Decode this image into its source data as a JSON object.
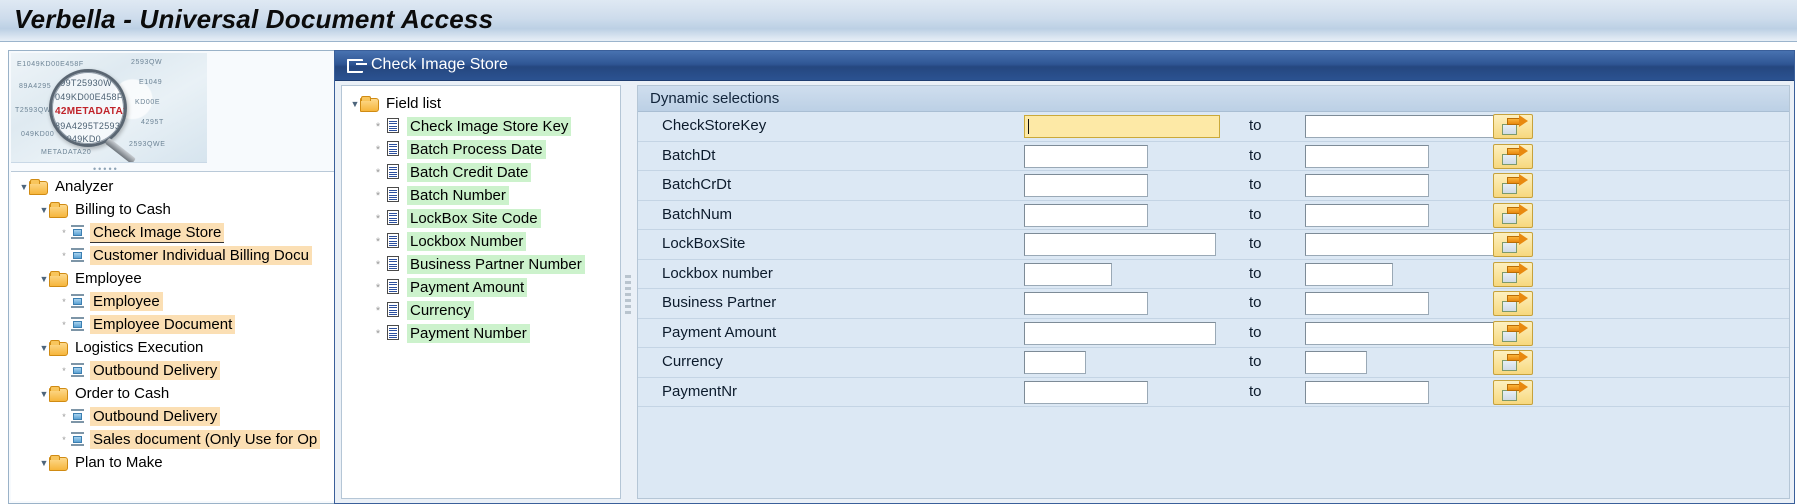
{
  "header": {
    "title": "Verbella - Universal Document Access"
  },
  "thumbnail": {
    "name": "metadata-magnifier-image",
    "lens_lines": [
      "299T25930W",
      "049KD00E458F",
      "42METADATA20",
      "89A4295T2593",
      "E1049KD0"
    ],
    "highlight_word": "METADATA"
  },
  "tree": {
    "items": [
      {
        "label": "Analyzer",
        "type": "folder",
        "depth": 0,
        "expanded": true,
        "highlight": "none"
      },
      {
        "label": "Billing to Cash",
        "type": "folder",
        "depth": 1,
        "expanded": true,
        "highlight": "none"
      },
      {
        "label": "Check Image Store",
        "type": "cube",
        "depth": 2,
        "expanded": false,
        "highlight": "orange",
        "selected": true
      },
      {
        "label": "Customer Individual Billing Docu",
        "type": "cube",
        "depth": 2,
        "expanded": false,
        "highlight": "orange"
      },
      {
        "label": "Employee",
        "type": "folder",
        "depth": 1,
        "expanded": true,
        "highlight": "none"
      },
      {
        "label": "Employee",
        "type": "cube",
        "depth": 2,
        "expanded": false,
        "highlight": "orange"
      },
      {
        "label": "Employee Document",
        "type": "cube",
        "depth": 2,
        "expanded": false,
        "highlight": "orange"
      },
      {
        "label": "Logistics Execution",
        "type": "folder",
        "depth": 1,
        "expanded": true,
        "highlight": "none"
      },
      {
        "label": "Outbound Delivery",
        "type": "cube",
        "depth": 2,
        "expanded": false,
        "highlight": "orange"
      },
      {
        "label": "Order to Cash",
        "type": "folder",
        "depth": 1,
        "expanded": true,
        "highlight": "none"
      },
      {
        "label": "Outbound Delivery",
        "type": "cube",
        "depth": 2,
        "expanded": false,
        "highlight": "orange"
      },
      {
        "label": "Sales document (Only Use for Op",
        "type": "cube",
        "depth": 2,
        "expanded": false,
        "highlight": "orange"
      },
      {
        "label": "Plan to Make",
        "type": "folder",
        "depth": 1,
        "expanded": true,
        "highlight": "none"
      }
    ]
  },
  "window": {
    "tab_label": "Check Image Store",
    "tab_icon": "export-window-icon"
  },
  "field_list": {
    "root_label": "Field list",
    "items": [
      {
        "label": "Check Image Store Key"
      },
      {
        "label": "Batch Process Date"
      },
      {
        "label": "Batch Credit Date"
      },
      {
        "label": "Batch Number"
      },
      {
        "label": "LockBox Site Code"
      },
      {
        "label": "Lockbox Number"
      },
      {
        "label": "Business Partner Number"
      },
      {
        "label": "Payment Amount"
      },
      {
        "label": "Currency"
      },
      {
        "label": "Payment Number"
      }
    ]
  },
  "dynamic_selections": {
    "title": "Dynamic selections",
    "to_label": "to",
    "select_button_icon": "multiple-selection-arrow-icon",
    "rows": [
      {
        "label": "CheckStoreKey",
        "low_value": "",
        "high_value": "",
        "low_width": 196,
        "high_width": 196,
        "focused": true
      },
      {
        "label": "BatchDt",
        "low_value": "",
        "high_value": "",
        "low_width": 124,
        "high_width": 124,
        "focused": false
      },
      {
        "label": "BatchCrDt",
        "low_value": "",
        "high_value": "",
        "low_width": 124,
        "high_width": 124,
        "focused": false
      },
      {
        "label": "BatchNum",
        "low_value": "",
        "high_value": "",
        "low_width": 124,
        "high_width": 124,
        "focused": false
      },
      {
        "label": "LockBoxSite",
        "low_value": "",
        "high_value": "",
        "low_width": 192,
        "high_width": 192,
        "focused": false
      },
      {
        "label": "Lockbox number",
        "low_value": "",
        "high_value": "",
        "low_width": 88,
        "high_width": 88,
        "focused": false
      },
      {
        "label": "Business Partner",
        "low_value": "",
        "high_value": "",
        "low_width": 124,
        "high_width": 124,
        "focused": false
      },
      {
        "label": "Payment Amount",
        "low_value": "",
        "high_value": "",
        "low_width": 192,
        "high_width": 192,
        "focused": false
      },
      {
        "label": "Currency",
        "low_value": "",
        "high_value": "",
        "low_width": 62,
        "high_width": 62,
        "focused": false
      },
      {
        "label": "PaymentNr",
        "low_value": "",
        "high_value": "",
        "low_width": 124,
        "high_width": 124,
        "focused": false
      }
    ]
  },
  "colors": {
    "title_bar": "#cddcec",
    "tab_blue": "#2f5694",
    "focus_yellow": "#fde9a6",
    "tree_highlight_orange": "#fbdfb4",
    "field_highlight_green": "#ccf2cc",
    "panel_blue": "#dce8f4",
    "button_yellow": "#f7d87e"
  }
}
